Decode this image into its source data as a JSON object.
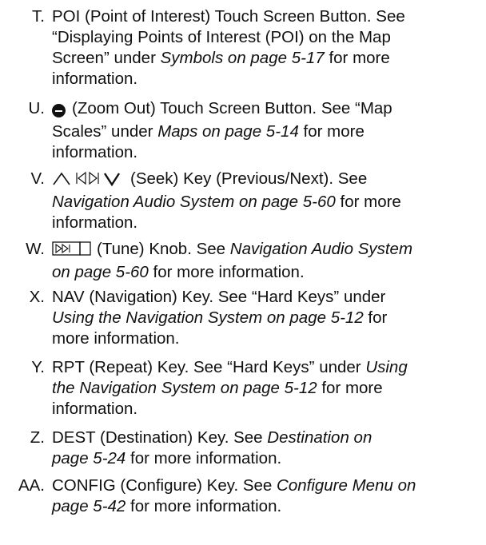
{
  "items": [
    {
      "letter": "T.",
      "lines": [
        [
          {
            "t": "POI (Point of Interest) Touch Screen Button. See"
          }
        ],
        [
          {
            "t": "“Displaying Points of Interest (POI) on the Map"
          }
        ],
        [
          {
            "t": "Screen” under "
          },
          {
            "t": "Symbols on page 5-17",
            "i": true
          },
          {
            "t": " for more"
          }
        ],
        [
          {
            "t": "information."
          }
        ]
      ]
    },
    {
      "letter": "U.",
      "icon": "zoom-out-icon",
      "lines": [
        [
          {
            "t": "(Zoom Out) Touch Screen Button. See “Map"
          }
        ],
        [
          {
            "t": "Scales” under "
          },
          {
            "t": "Maps on page 5-14",
            "i": true
          },
          {
            "t": " for more"
          }
        ],
        [
          {
            "t": "information."
          }
        ]
      ]
    },
    {
      "letter": "V.",
      "icon": "seek-icon",
      "lines": [
        [
          {
            "t": "(Seek) Key (Previous/Next). See"
          }
        ],
        [
          {
            "t": "Navigation Audio System on page 5-60",
            "i": true
          },
          {
            "t": " for more"
          }
        ],
        [
          {
            "t": "information."
          }
        ]
      ]
    },
    {
      "letter": "W.",
      "icon": "tune-icon",
      "lines": [
        [
          {
            "t": "(Tune) Knob. See "
          },
          {
            "t": "Navigation Audio System",
            "i": true
          }
        ],
        [
          {
            "t": "on page 5-60",
            "i": true
          },
          {
            "t": " for more information."
          }
        ]
      ]
    },
    {
      "letter": "X.",
      "lines": [
        [
          {
            "t": "NAV (Navigation) Key. See “Hard Keys” under"
          }
        ],
        [
          {
            "t": "Using the Navigation System on page 5-12",
            "i": true
          },
          {
            "t": " for"
          }
        ],
        [
          {
            "t": "more information."
          }
        ]
      ]
    },
    {
      "letter": "Y.",
      "lines": [
        [
          {
            "t": "RPT (Repeat) Key. See “Hard Keys” under "
          },
          {
            "t": "Using",
            "i": true
          }
        ],
        [
          {
            "t": "the Navigation System on page 5-12",
            "i": true
          },
          {
            "t": " for more"
          }
        ],
        [
          {
            "t": "information."
          }
        ]
      ]
    },
    {
      "letter": "Z.",
      "lines": [
        [
          {
            "t": "DEST (Destination) Key. See "
          },
          {
            "t": "Destination on",
            "i": true
          }
        ],
        [
          {
            "t": "page 5-24",
            "i": true
          },
          {
            "t": " for more information."
          }
        ]
      ]
    },
    {
      "letter": "AA.",
      "lines": [
        [
          {
            "t": "CONFIG (Configure) Key. See "
          },
          {
            "t": "Configure Menu on",
            "i": true
          }
        ],
        [
          {
            "t": "page 5-42",
            "i": true
          },
          {
            "t": " for more information."
          }
        ]
      ]
    }
  ]
}
